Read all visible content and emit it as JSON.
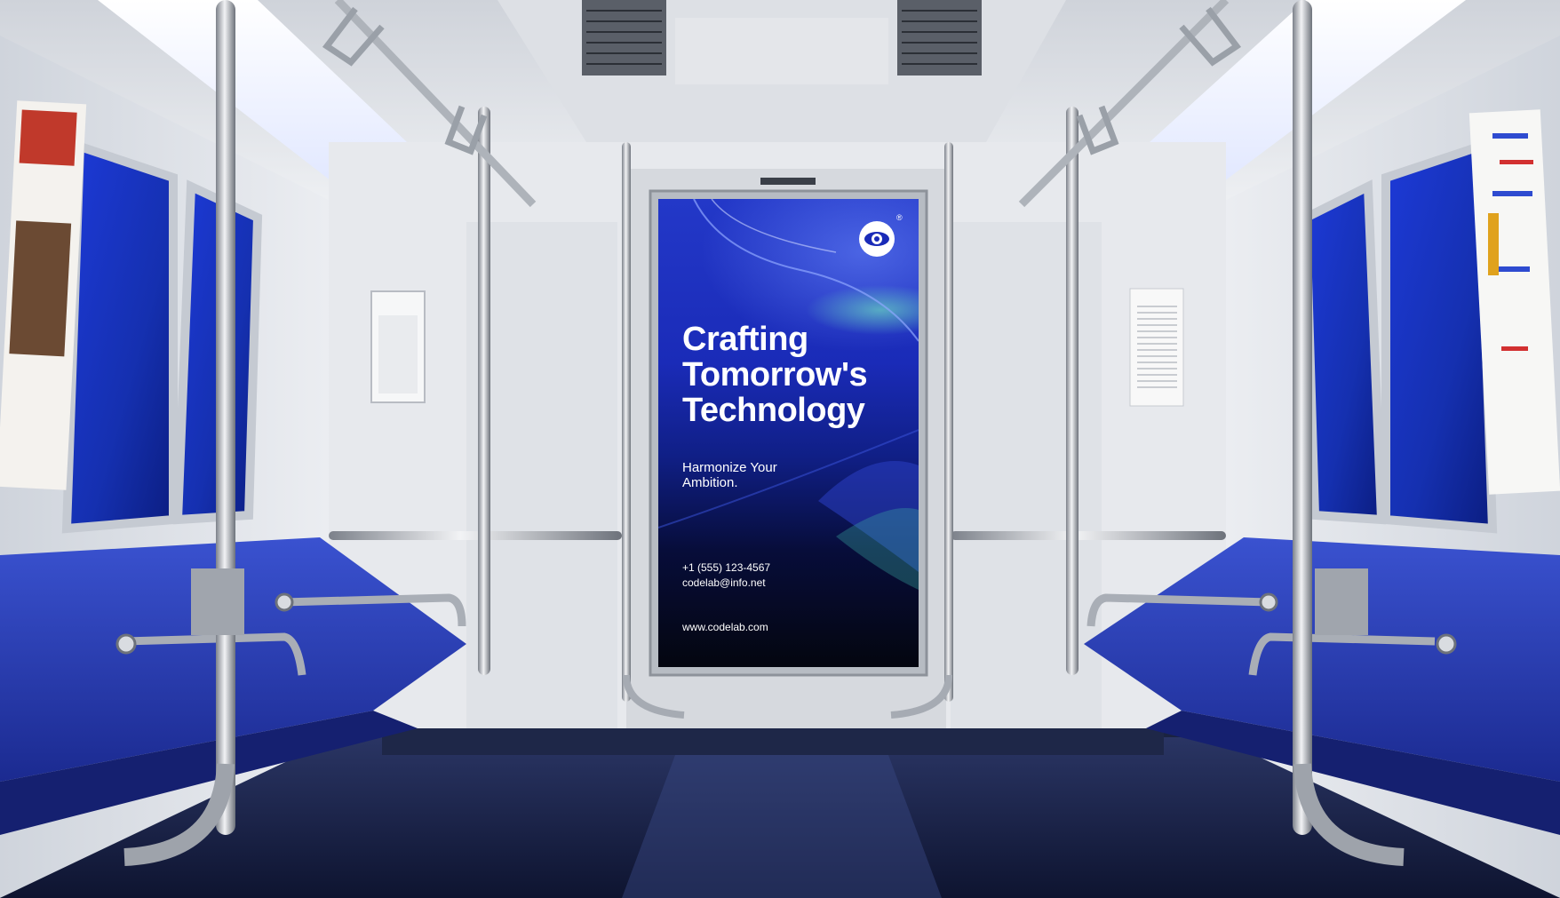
{
  "ad": {
    "headline_lines": [
      "Crafting",
      "Tomorrow's",
      "Technology"
    ],
    "tagline_lines": [
      "Harmonize Your",
      "Ambition."
    ],
    "phone": "+1 (555) 123-4567",
    "email": "codelab@info.net",
    "website": "www.codelab.com",
    "logo_icon": "eye-icon",
    "registered_mark": "®"
  },
  "colors": {
    "seat_blue": "#2a3fb0",
    "poster_blue": "#1a2bb8",
    "floor_navy": "#1c2444",
    "wall_white": "#e8eaee"
  }
}
